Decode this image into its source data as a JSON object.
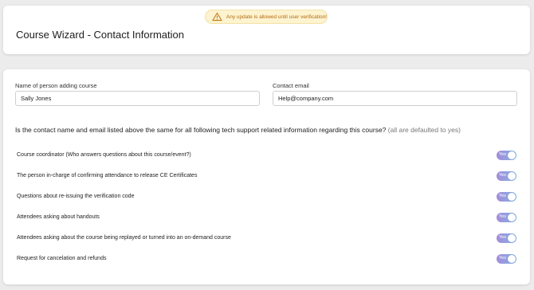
{
  "banner": {
    "icon": "warning-triangle-icon",
    "text": "Any update is allowed until user verification!"
  },
  "header": {
    "title": "Course Wizard - Contact Information"
  },
  "form": {
    "name_label": "Name of person adding course",
    "name_value": "Sally Jones",
    "email_label": "Contact email",
    "email_value": "Help@company.com",
    "question": "Is the contact name and email listed above the same for all following tech support related information regarding this course?",
    "question_hint": "(all are defaulted to yes)"
  },
  "toggles": [
    {
      "label": "Course coordinator (Who answers questions about this course/event?)",
      "state": "Yes"
    },
    {
      "label": "The person in-charge of confirming attendance to release CE Certificates",
      "state": "Yes"
    },
    {
      "label": "Questions about re-issuing the verification code",
      "state": "Yes"
    },
    {
      "label": "Attendees asking about handouts",
      "state": "Yes"
    },
    {
      "label": "Attendees asking about the course being replayed or turned into an on-demand course",
      "state": "Yes"
    },
    {
      "label": "Request for cancelation and refunds",
      "state": "Yes"
    }
  ],
  "colors": {
    "toggle_gradient_start": "#a58bd8",
    "toggle_gradient_end": "#7fb6e8",
    "banner_bg": "#fdf3cf",
    "banner_text": "#b46a12"
  }
}
